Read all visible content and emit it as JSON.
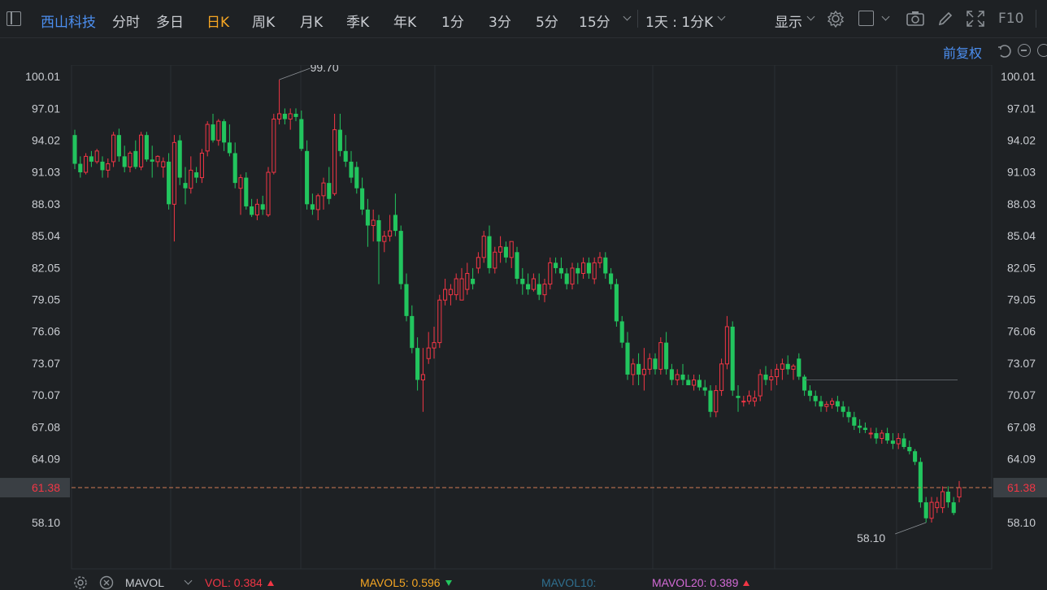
{
  "toolbar": {
    "stock_name": "西山科技",
    "periods": [
      "分时",
      "多日",
      "日K",
      "周K",
      "月K",
      "季K",
      "年K",
      "1分",
      "3分",
      "5分",
      "15分"
    ],
    "active_period": "日K",
    "range_select": "1天 : 1分K",
    "display_label": "显示",
    "f10_label": "F10"
  },
  "chart_header": {
    "adjust_label": "前复权"
  },
  "colors": {
    "up": "#f23645",
    "down": "#22c55e",
    "accent": "#4c8ff0",
    "active": "#f5a623",
    "grid": "#2b2f33"
  },
  "chart_data": {
    "type": "candlestick",
    "y_ticks": [
      "100.01",
      "97.01",
      "94.02",
      "91.03",
      "88.03",
      "85.04",
      "82.05",
      "79.05",
      "76.06",
      "73.07",
      "70.07",
      "67.08",
      "64.09",
      "58.10"
    ],
    "ylim": [
      56.0,
      102.0
    ],
    "current_price": "61.38",
    "high_label": "99.70",
    "low_label": "58.10",
    "grid": true,
    "candles": [
      [
        94.5,
        95.0,
        91.3,
        91.8
      ],
      [
        91.8,
        92.5,
        90.5,
        91.0
      ],
      [
        91.0,
        92.8,
        90.8,
        92.5
      ],
      [
        92.5,
        93.0,
        91.5,
        92.0
      ],
      [
        92.0,
        93.2,
        91.8,
        93.0
      ],
      [
        92.0,
        92.5,
        90.5,
        91.2
      ],
      [
        91.2,
        92.3,
        90.5,
        91.8
      ],
      [
        92.0,
        94.8,
        91.5,
        94.5
      ],
      [
        94.5,
        95.1,
        92.0,
        92.5
      ],
      [
        92.5,
        93.5,
        91.0,
        91.5
      ],
      [
        91.5,
        93.0,
        91.0,
        92.8
      ],
      [
        93.0,
        94.0,
        91.3,
        91.5
      ],
      [
        91.5,
        94.8,
        91.2,
        94.5
      ],
      [
        94.5,
        94.8,
        92.0,
        92.2
      ],
      [
        92.2,
        93.5,
        90.5,
        92.0
      ],
      [
        92.0,
        92.6,
        91.5,
        92.5
      ],
      [
        91.5,
        92.4,
        90.5,
        92.0
      ],
      [
        92.0,
        92.8,
        87.5,
        88.0
      ],
      [
        88.0,
        94.5,
        84.5,
        93.8
      ],
      [
        94.0,
        94.5,
        89.8,
        90.5
      ],
      [
        90.0,
        91.5,
        88.0,
        89.5
      ],
      [
        89.5,
        92.5,
        89.0,
        91.2
      ],
      [
        91.0,
        91.5,
        90.0,
        90.5
      ],
      [
        90.5,
        93.2,
        90.0,
        92.8
      ],
      [
        93.0,
        95.8,
        92.5,
        95.5
      ],
      [
        95.5,
        96.5,
        93.8,
        94.0
      ],
      [
        94.0,
        96.0,
        93.5,
        95.8
      ],
      [
        95.8,
        96.0,
        93.0,
        93.8
      ],
      [
        93.8,
        95.5,
        92.5,
        92.8
      ],
      [
        92.8,
        93.8,
        89.5,
        90.0
      ],
      [
        89.5,
        90.8,
        87.0,
        90.5
      ],
      [
        90.5,
        91.0,
        87.5,
        87.8
      ],
      [
        87.8,
        88.5,
        86.8,
        87.0
      ],
      [
        87.0,
        88.5,
        86.5,
        88.0
      ],
      [
        88.0,
        88.8,
        87.0,
        87.5
      ],
      [
        87.0,
        91.5,
        86.8,
        91.0
      ],
      [
        91.0,
        96.5,
        90.8,
        96.0
      ],
      [
        96.0,
        99.7,
        95.5,
        96.5
      ],
      [
        96.5,
        97.0,
        95.5,
        96.0
      ],
      [
        96.0,
        97.0,
        95.0,
        96.5
      ],
      [
        96.5,
        97.0,
        95.8,
        96.2
      ],
      [
        96.0,
        96.8,
        93.0,
        93.2
      ],
      [
        93.0,
        94.0,
        87.5,
        88.0
      ],
      [
        88.0,
        89.0,
        87.0,
        87.5
      ],
      [
        87.5,
        89.0,
        86.5,
        88.8
      ],
      [
        88.8,
        90.5,
        87.5,
        90.0
      ],
      [
        90.0,
        91.5,
        88.0,
        88.5
      ],
      [
        89.0,
        96.5,
        88.8,
        95.0
      ],
      [
        95.0,
        96.5,
        92.5,
        93.0
      ],
      [
        93.0,
        94.5,
        91.5,
        92.0
      ],
      [
        92.0,
        93.0,
        90.0,
        90.5
      ],
      [
        91.5,
        92.0,
        89.0,
        89.5
      ],
      [
        89.5,
        90.5,
        87.0,
        87.5
      ],
      [
        87.5,
        88.5,
        84.0,
        86.0
      ],
      [
        86.0,
        87.5,
        84.5,
        86.5
      ],
      [
        86.5,
        87.0,
        80.5,
        84.5
      ],
      [
        84.5,
        85.5,
        83.5,
        85.0
      ],
      [
        85.0,
        87.0,
        84.5,
        85.5
      ],
      [
        87.0,
        89.0,
        85.0,
        85.5
      ],
      [
        85.5,
        86.0,
        80.0,
        80.5
      ],
      [
        80.5,
        81.5,
        77.0,
        77.5
      ],
      [
        77.5,
        78.5,
        74.0,
        74.5
      ],
      [
        74.5,
        75.5,
        70.5,
        71.5
      ],
      [
        71.5,
        74.5,
        68.5,
        72.0
      ],
      [
        73.5,
        76.0,
        73.0,
        74.5
      ],
      [
        74.5,
        76.5,
        73.5,
        75.0
      ],
      [
        75.0,
        79.5,
        74.5,
        79.0
      ],
      [
        79.0,
        81.0,
        78.5,
        80.0
      ],
      [
        79.5,
        80.5,
        78.5,
        80.0
      ],
      [
        79.5,
        81.5,
        79.0,
        81.0
      ],
      [
        79.0,
        82.0,
        79.0,
        81.0
      ],
      [
        80.0,
        82.5,
        79.5,
        81.5
      ],
      [
        81.0,
        82.0,
        80.0,
        80.5
      ],
      [
        82.0,
        83.5,
        81.5,
        83.0
      ],
      [
        83.0,
        85.5,
        82.5,
        85.0
      ],
      [
        85.0,
        86.0,
        81.5,
        82.0
      ],
      [
        82.0,
        84.0,
        81.5,
        83.5
      ],
      [
        83.5,
        85.0,
        82.5,
        84.0
      ],
      [
        84.0,
        84.5,
        82.5,
        83.0
      ],
      [
        83.0,
        84.5,
        82.0,
        84.5
      ],
      [
        83.5,
        84.0,
        80.5,
        81.0
      ],
      [
        81.0,
        82.0,
        79.5,
        80.5
      ],
      [
        80.5,
        81.5,
        79.5,
        80.0
      ],
      [
        80.0,
        81.5,
        79.8,
        81.0
      ],
      [
        80.5,
        81.5,
        79.0,
        79.5
      ],
      [
        79.5,
        81.0,
        78.8,
        80.5
      ],
      [
        80.5,
        83.0,
        80.0,
        82.5
      ],
      [
        82.5,
        83.0,
        81.5,
        82.0
      ],
      [
        82.0,
        83.0,
        81.0,
        81.5
      ],
      [
        81.5,
        82.0,
        80.0,
        80.5
      ],
      [
        80.5,
        82.5,
        80.0,
        82.0
      ],
      [
        82.0,
        82.5,
        80.5,
        81.5
      ],
      [
        81.5,
        83.0,
        81.0,
        82.5
      ],
      [
        82.5,
        83.0,
        81.0,
        81.5
      ],
      [
        81.0,
        83.0,
        80.5,
        82.5
      ],
      [
        82.5,
        83.5,
        82.0,
        83.0
      ],
      [
        83.0,
        83.5,
        81.0,
        81.5
      ],
      [
        81.5,
        82.0,
        80.0,
        80.5
      ],
      [
        80.5,
        81.0,
        76.5,
        77.0
      ],
      [
        77.0,
        77.5,
        74.5,
        75.0
      ],
      [
        75.0,
        76.0,
        71.5,
        72.0
      ],
      [
        72.0,
        73.5,
        71.0,
        73.0
      ],
      [
        73.0,
        74.0,
        71.0,
        72.0
      ],
      [
        72.0,
        74.5,
        70.5,
        72.5
      ],
      [
        72.5,
        74.0,
        72.0,
        73.5
      ],
      [
        73.5,
        74.0,
        72.0,
        72.5
      ],
      [
        72.5,
        75.5,
        72.0,
        75.0
      ],
      [
        75.0,
        76.0,
        72.0,
        72.5
      ],
      [
        72.5,
        73.0,
        71.0,
        71.5
      ],
      [
        71.5,
        72.5,
        71.0,
        72.0
      ],
      [
        72.0,
        73.0,
        71.0,
        71.5
      ],
      [
        71.5,
        72.0,
        71.0,
        71.0
      ],
      [
        71.0,
        72.0,
        70.5,
        71.5
      ],
      [
        71.5,
        72.0,
        70.5,
        70.8
      ],
      [
        70.8,
        71.5,
        70.0,
        70.5
      ],
      [
        70.5,
        71.0,
        68.0,
        68.5
      ],
      [
        68.5,
        71.0,
        68.0,
        70.5
      ],
      [
        70.5,
        73.5,
        70.0,
        73.0
      ],
      [
        73.0,
        77.5,
        72.5,
        76.5
      ],
      [
        76.5,
        77.0,
        70.0,
        70.5
      ],
      [
        70.0,
        71.0,
        68.5,
        69.8
      ],
      [
        69.5,
        70.0,
        69.0,
        69.5
      ],
      [
        69.5,
        70.5,
        69.2,
        70.0
      ],
      [
        69.5,
        70.5,
        69.0,
        69.8
      ],
      [
        70.0,
        72.5,
        69.5,
        72.0
      ],
      [
        72.0,
        72.8,
        71.0,
        71.5
      ],
      [
        71.5,
        72.5,
        70.5,
        71.8
      ],
      [
        71.8,
        73.0,
        71.0,
        72.5
      ],
      [
        72.5,
        73.5,
        71.5,
        73.0
      ],
      [
        73.0,
        73.8,
        72.0,
        72.5
      ],
      [
        72.5,
        73.0,
        71.5,
        72.8
      ],
      [
        73.5,
        74.0,
        71.5,
        71.8
      ],
      [
        71.8,
        72.0,
        70.0,
        70.5
      ],
      [
        70.5,
        71.0,
        69.5,
        70.0
      ],
      [
        70.0,
        70.5,
        69.0,
        69.5
      ],
      [
        69.5,
        70.0,
        68.5,
        69.0
      ],
      [
        69.0,
        69.5,
        68.5,
        69.2
      ],
      [
        69.2,
        69.8,
        68.8,
        69.5
      ],
      [
        69.5,
        70.0,
        68.5,
        69.0
      ],
      [
        69.0,
        69.5,
        68.0,
        68.5
      ],
      [
        68.5,
        69.0,
        67.5,
        68.0
      ],
      [
        68.0,
        68.5,
        66.8,
        67.2
      ],
      [
        67.2,
        67.8,
        66.5,
        67.0
      ],
      [
        67.0,
        67.5,
        66.5,
        66.8
      ],
      [
        66.5,
        67.0,
        66.0,
        66.5
      ],
      [
        66.5,
        67.0,
        65.5,
        66.0
      ],
      [
        66.0,
        66.8,
        65.5,
        66.5
      ],
      [
        66.5,
        67.0,
        65.5,
        65.8
      ],
      [
        65.8,
        66.5,
        65.0,
        65.5
      ],
      [
        65.5,
        66.5,
        65.0,
        66.0
      ],
      [
        66.0,
        66.5,
        65.0,
        65.2
      ],
      [
        65.2,
        65.8,
        64.5,
        64.8
      ],
      [
        64.8,
        65.0,
        63.5,
        63.8
      ],
      [
        63.8,
        64.2,
        59.5,
        60.0
      ],
      [
        60.0,
        60.5,
        58.1,
        58.5
      ],
      [
        58.5,
        60.5,
        58.1,
        60.0
      ],
      [
        59.5,
        60.5,
        59.0,
        60.0
      ],
      [
        59.5,
        61.5,
        59.0,
        61.0
      ],
      [
        61.0,
        61.5,
        59.5,
        60.0
      ],
      [
        60.0,
        60.5,
        58.8,
        59.0
      ],
      [
        60.5,
        62.0,
        60.0,
        61.38
      ]
    ]
  },
  "indicator": {
    "name": "MAVOL",
    "vol_label": "VOL: 0.384",
    "mavol5_label": "MAVOL5: 0.596",
    "mavol10_label": "MAVOL10:",
    "mavol20_label": "MAVOL20: 0.389"
  }
}
